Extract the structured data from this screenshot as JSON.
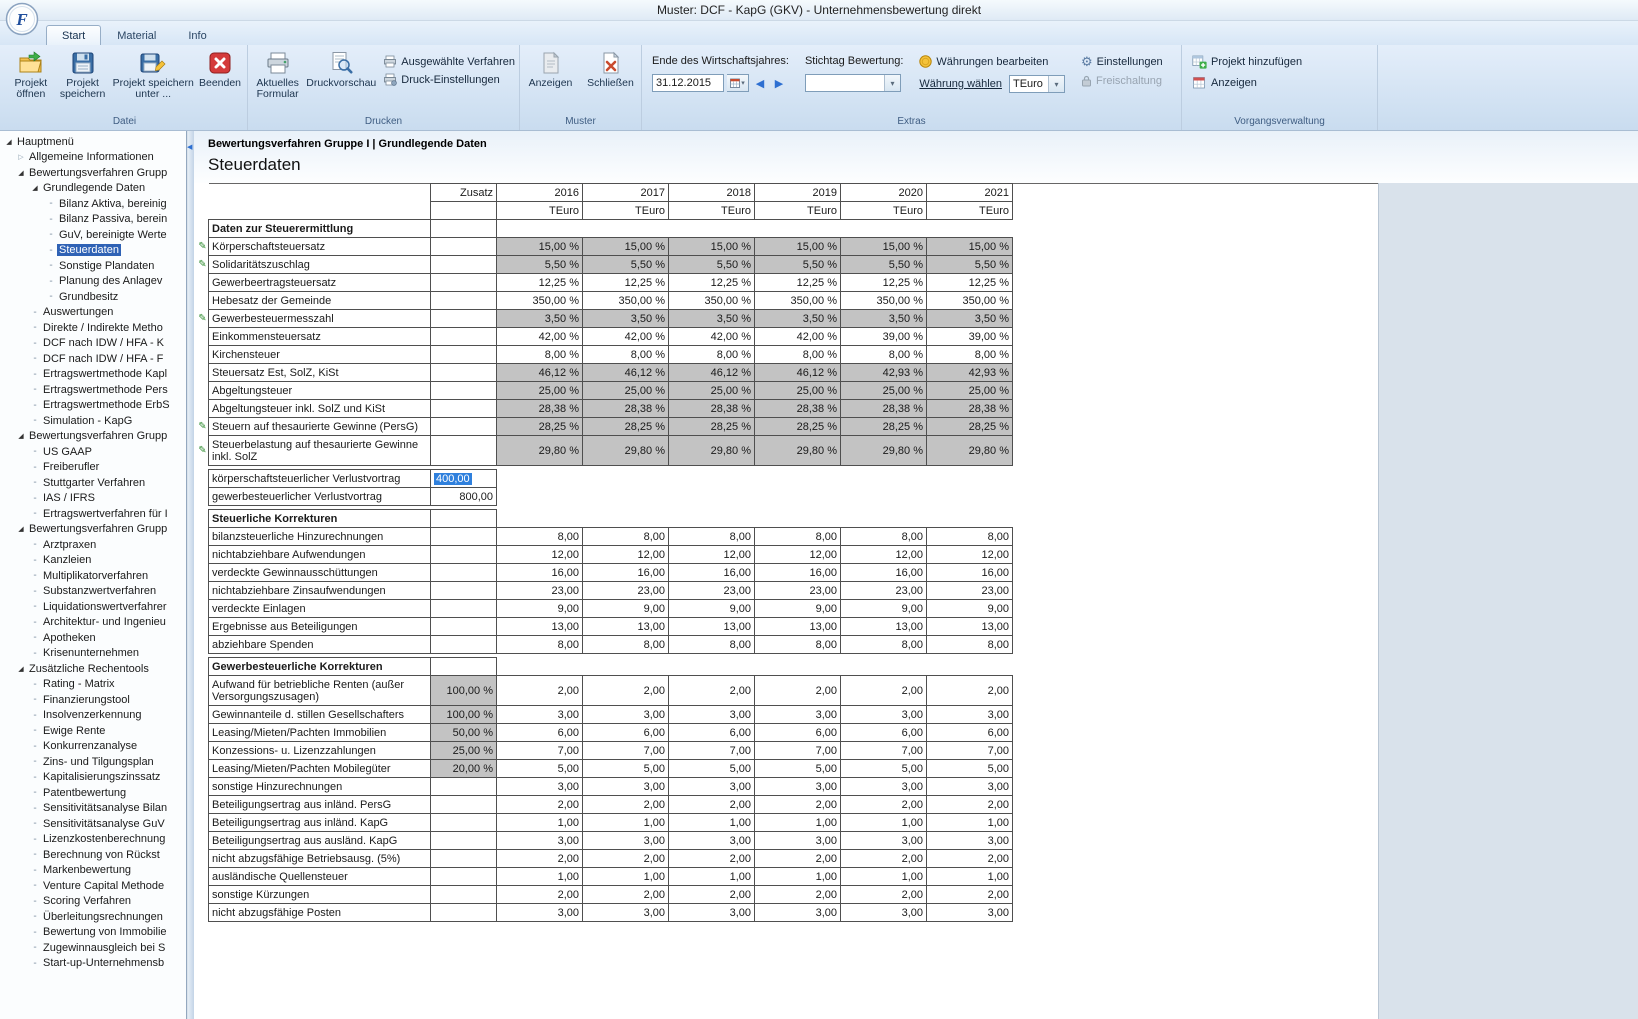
{
  "window": {
    "title": "Muster: DCF - KapG (GKV) - Unternehmensbewertung direkt"
  },
  "tabs": [
    {
      "label": "Start",
      "active": true
    },
    {
      "label": "Material",
      "active": false
    },
    {
      "label": "Info",
      "active": false
    }
  ],
  "ribbon": {
    "datei": {
      "label": "Datei",
      "open": "Projekt öffnen",
      "save": "Projekt speichern",
      "save_as": "Projekt speichern unter ...",
      "quit": "Beenden"
    },
    "drucken": {
      "label": "Drucken",
      "current_form": "Aktuelles Formular",
      "preview": "Druckvorschau",
      "selected_procedures": "Ausgewählte Verfahren",
      "print_settings": "Druck-Einstellungen"
    },
    "muster": {
      "label": "Muster",
      "show": "Anzeigen",
      "close": "Schließen"
    },
    "extras": {
      "label": "Extras",
      "fiscal_year_label": "Ende des Wirtschaftsjahres:",
      "fiscal_year_value": "31.12.2015",
      "valuation_label": "Stichtag Bewertung:",
      "valuation_value": "",
      "edit_currencies": "Währungen bearbeiten",
      "choose_currency": "Währung wählen",
      "currency_value": "TEuro",
      "settings": "Einstellungen",
      "activation": "Freischaltung"
    },
    "vorgang": {
      "label": "Vorgangsverwaltung",
      "add_project": "Projekt hinzufügen",
      "show": "Anzeigen"
    }
  },
  "content": {
    "breadcrumb": "Bewertungsverfahren Gruppe I | Grundlegende Daten",
    "title": "Steuerdaten"
  },
  "sidebar": {
    "items": [
      {
        "label": "Hauptmenü",
        "level": 0,
        "state": "expanded"
      },
      {
        "label": "Allgemeine Informationen",
        "level": 1,
        "state": "collapsed"
      },
      {
        "label": "Bewertungsverfahren Grupp",
        "level": 1,
        "state": "expanded"
      },
      {
        "label": "Grundlegende Daten",
        "level": 2,
        "state": "expanded"
      },
      {
        "label": "Bilanz Aktiva, bereinig",
        "level": 3,
        "state": "leaf"
      },
      {
        "label": "Bilanz Passiva, berein",
        "level": 3,
        "state": "leaf"
      },
      {
        "label": "GuV, bereinigte Werte",
        "level": 3,
        "state": "leaf"
      },
      {
        "label": "Steuerdaten",
        "level": 3,
        "state": "leaf",
        "selected": true
      },
      {
        "label": "Sonstige Plandaten",
        "level": 3,
        "state": "leaf"
      },
      {
        "label": "Planung des Anlagev",
        "level": 3,
        "state": "leaf"
      },
      {
        "label": "Grundbesitz",
        "level": 3,
        "state": "leaf"
      },
      {
        "label": "Auswertungen",
        "level": 2,
        "state": "leaf"
      },
      {
        "label": "Direkte / Indirekte Metho",
        "level": 2,
        "state": "leaf"
      },
      {
        "label": "DCF nach IDW / HFA - K",
        "level": 2,
        "state": "leaf"
      },
      {
        "label": "DCF nach IDW / HFA - F",
        "level": 2,
        "state": "leaf"
      },
      {
        "label": "Ertragswertmethode Kapl",
        "level": 2,
        "state": "leaf"
      },
      {
        "label": "Ertragswertmethode Pers",
        "level": 2,
        "state": "leaf"
      },
      {
        "label": "Ertragswertmethode ErbS",
        "level": 2,
        "state": "leaf"
      },
      {
        "label": "Simulation - KapG",
        "level": 2,
        "state": "leaf"
      },
      {
        "label": "Bewertungsverfahren Grupp",
        "level": 1,
        "state": "expanded"
      },
      {
        "label": "US GAAP",
        "level": 2,
        "state": "leaf"
      },
      {
        "label": "Freiberufler",
        "level": 2,
        "state": "leaf"
      },
      {
        "label": "Stuttgarter Verfahren",
        "level": 2,
        "state": "leaf"
      },
      {
        "label": "IAS / IFRS",
        "level": 2,
        "state": "leaf"
      },
      {
        "label": "Ertragswertverfahren für I",
        "level": 2,
        "state": "leaf"
      },
      {
        "label": "Bewertungsverfahren Grupp",
        "level": 1,
        "state": "expanded"
      },
      {
        "label": "Arztpraxen",
        "level": 2,
        "state": "leaf"
      },
      {
        "label": "Kanzleien",
        "level": 2,
        "state": "leaf"
      },
      {
        "label": "Multiplikatorverfahren",
        "level": 2,
        "state": "leaf"
      },
      {
        "label": "Substanzwertverfahren",
        "level": 2,
        "state": "leaf"
      },
      {
        "label": "Liquidationswertverfahrer",
        "level": 2,
        "state": "leaf"
      },
      {
        "label": "Architektur- und Ingenieu",
        "level": 2,
        "state": "leaf"
      },
      {
        "label": "Apotheken",
        "level": 2,
        "state": "leaf"
      },
      {
        "label": "Krisenunternehmen",
        "level": 2,
        "state": "leaf"
      },
      {
        "label": "Zusätzliche Rechentools",
        "level": 1,
        "state": "expanded"
      },
      {
        "label": "Rating - Matrix",
        "level": 2,
        "state": "leaf"
      },
      {
        "label": "Finanzierungstool",
        "level": 2,
        "state": "leaf"
      },
      {
        "label": "Insolvenzerkennung",
        "level": 2,
        "state": "leaf"
      },
      {
        "label": "Ewige Rente",
        "level": 2,
        "state": "leaf"
      },
      {
        "label": "Konkurrenzanalyse",
        "level": 2,
        "state": "leaf"
      },
      {
        "label": "Zins- und Tilgungsplan",
        "level": 2,
        "state": "leaf"
      },
      {
        "label": "Kapitalisierungszinssatz",
        "level": 2,
        "state": "leaf"
      },
      {
        "label": "Patentbewertung",
        "level": 2,
        "state": "leaf"
      },
      {
        "label": "Sensitivitätsanalyse Bilan",
        "level": 2,
        "state": "leaf"
      },
      {
        "label": "Sensitivitätsanalyse GuV",
        "level": 2,
        "state": "leaf"
      },
      {
        "label": "Lizenzkostenberechnung",
        "level": 2,
        "state": "leaf"
      },
      {
        "label": "Berechnung von Rückst",
        "level": 2,
        "state": "leaf"
      },
      {
        "label": "Markenbewertung",
        "level": 2,
        "state": "leaf"
      },
      {
        "label": "Venture Capital Methode",
        "level": 2,
        "state": "leaf"
      },
      {
        "label": "Scoring Verfahren",
        "level": 2,
        "state": "leaf"
      },
      {
        "label": "Überleitungsrechnungen",
        "level": 2,
        "state": "leaf"
      },
      {
        "label": "Bewertung von Immobilie",
        "level": 2,
        "state": "leaf"
      },
      {
        "label": "Zugewinnausgleich bei S",
        "level": 2,
        "state": "leaf"
      },
      {
        "label": "Start-up-Unternehmensb",
        "level": 2,
        "state": "leaf"
      }
    ]
  },
  "table": {
    "columns": [
      "Zusatz",
      "2016",
      "2017",
      "2018",
      "2019",
      "2020",
      "2021"
    ],
    "unit": "TEuro",
    "rows": [
      {
        "type": "section",
        "label": "Daten zur Steuerermittlung"
      },
      {
        "type": "data",
        "label": "Körperschaftsteuersatz",
        "pencil": true,
        "gray": true,
        "zusatz": "",
        "values": [
          "15,00 %",
          "15,00 %",
          "15,00 %",
          "15,00 %",
          "15,00 %",
          "15,00 %"
        ]
      },
      {
        "type": "data",
        "label": "Solidaritätszuschlag",
        "pencil": true,
        "gray": true,
        "zusatz": "",
        "values": [
          "5,50 %",
          "5,50 %",
          "5,50 %",
          "5,50 %",
          "5,50 %",
          "5,50 %"
        ]
      },
      {
        "type": "data",
        "label": "Gewerbeertragsteuersatz",
        "zusatz": "",
        "values": [
          "12,25 %",
          "12,25 %",
          "12,25 %",
          "12,25 %",
          "12,25 %",
          "12,25 %"
        ]
      },
      {
        "type": "data",
        "label": "Hebesatz der Gemeinde",
        "zusatz": "",
        "values": [
          "350,00 %",
          "350,00 %",
          "350,00 %",
          "350,00 %",
          "350,00 %",
          "350,00 %"
        ]
      },
      {
        "type": "data",
        "label": "Gewerbesteuermesszahl",
        "pencil": true,
        "gray": true,
        "zusatz": "",
        "values": [
          "3,50 %",
          "3,50 %",
          "3,50 %",
          "3,50 %",
          "3,50 %",
          "3,50 %"
        ]
      },
      {
        "type": "data",
        "label": "Einkommensteuersatz",
        "zusatz": "",
        "values": [
          "42,00 %",
          "42,00 %",
          "42,00 %",
          "42,00 %",
          "39,00 %",
          "39,00 %"
        ]
      },
      {
        "type": "data",
        "label": "Kirchensteuer",
        "zusatz": "",
        "values": [
          "8,00 %",
          "8,00 %",
          "8,00 %",
          "8,00 %",
          "8,00 %",
          "8,00 %"
        ]
      },
      {
        "type": "data",
        "label": "Steuersatz Est, SolZ, KiSt",
        "gray": true,
        "zusatz": "",
        "values": [
          "46,12 %",
          "46,12 %",
          "46,12 %",
          "46,12 %",
          "42,93 %",
          "42,93 %"
        ]
      },
      {
        "type": "data",
        "label": "Abgeltungsteuer",
        "gray": true,
        "zusatz": "",
        "values": [
          "25,00 %",
          "25,00 %",
          "25,00 %",
          "25,00 %",
          "25,00 %",
          "25,00 %"
        ]
      },
      {
        "type": "data",
        "label": "Abgeltungsteuer inkl. SolZ und KiSt",
        "gray": true,
        "zusatz": "",
        "values": [
          "28,38 %",
          "28,38 %",
          "28,38 %",
          "28,38 %",
          "28,38 %",
          "28,38 %"
        ]
      },
      {
        "type": "data",
        "label": "Steuern auf thesaurierte Gewinne (PersG)",
        "pencil": true,
        "gray": true,
        "zusatz": "",
        "values": [
          "28,25 %",
          "28,25 %",
          "28,25 %",
          "28,25 %",
          "28,25 %",
          "28,25 %"
        ]
      },
      {
        "type": "data",
        "label": "Steuerbelastung auf thesaurierte Gewinne inkl. SolZ",
        "pencil": true,
        "gray": true,
        "two_line": true,
        "zusatz": "",
        "values": [
          "29,80 %",
          "29,80 %",
          "29,80 %",
          "29,80 %",
          "29,80 %",
          "29,80 %"
        ]
      },
      {
        "type": "gap"
      },
      {
        "type": "zusatz_only",
        "label": "körperschaftsteuerlicher Verlustvortrag",
        "zusatz": "400,00",
        "selected": true
      },
      {
        "type": "zusatz_only",
        "label": "gewerbesteuerlicher Verlustvortrag",
        "zusatz": "800,00"
      },
      {
        "type": "gap"
      },
      {
        "type": "section",
        "label": "Steuerliche Korrekturen"
      },
      {
        "type": "data",
        "label": "bilanzsteuerliche Hinzurechnungen",
        "zusatz": "",
        "values": [
          "8,00",
          "8,00",
          "8,00",
          "8,00",
          "8,00",
          "8,00"
        ]
      },
      {
        "type": "data",
        "label": "nichtabziehbare Aufwendungen",
        "zusatz": "",
        "values": [
          "12,00",
          "12,00",
          "12,00",
          "12,00",
          "12,00",
          "12,00"
        ]
      },
      {
        "type": "data",
        "label": "verdeckte Gewinnausschüttungen",
        "zusatz": "",
        "values": [
          "16,00",
          "16,00",
          "16,00",
          "16,00",
          "16,00",
          "16,00"
        ]
      },
      {
        "type": "data",
        "label": "nichtabziehbare Zinsaufwendungen",
        "zusatz": "",
        "values": [
          "23,00",
          "23,00",
          "23,00",
          "23,00",
          "23,00",
          "23,00"
        ]
      },
      {
        "type": "data",
        "label": "verdeckte Einlagen",
        "zusatz": "",
        "values": [
          "9,00",
          "9,00",
          "9,00",
          "9,00",
          "9,00",
          "9,00"
        ]
      },
      {
        "type": "data",
        "label": "Ergebnisse aus Beteiligungen",
        "zusatz": "",
        "values": [
          "13,00",
          "13,00",
          "13,00",
          "13,00",
          "13,00",
          "13,00"
        ]
      },
      {
        "type": "data",
        "label": "abziehbare Spenden",
        "zusatz": "",
        "values": [
          "8,00",
          "8,00",
          "8,00",
          "8,00",
          "8,00",
          "8,00"
        ]
      },
      {
        "type": "gap"
      },
      {
        "type": "section",
        "label": "Gewerbesteuerliche Korrekturen"
      },
      {
        "type": "data",
        "label": "Aufwand für betriebliche Renten (außer Versorgungszusagen)",
        "two_line": true,
        "zusatz": "100,00 %",
        "zusatz_gray": true,
        "values": [
          "2,00",
          "2,00",
          "2,00",
          "2,00",
          "2,00",
          "2,00"
        ]
      },
      {
        "type": "data",
        "label": "Gewinnanteile d. stillen Gesellschafters",
        "zusatz": "100,00 %",
        "zusatz_gray": true,
        "values": [
          "3,00",
          "3,00",
          "3,00",
          "3,00",
          "3,00",
          "3,00"
        ]
      },
      {
        "type": "data",
        "label": "Leasing/Mieten/Pachten Immobilien",
        "zusatz": "50,00 %",
        "zusatz_gray": true,
        "values": [
          "6,00",
          "6,00",
          "6,00",
          "6,00",
          "6,00",
          "6,00"
        ]
      },
      {
        "type": "data",
        "label": "Konzessions- u. Lizenzzahlungen",
        "zusatz": "25,00 %",
        "zusatz_gray": true,
        "values": [
          "7,00",
          "7,00",
          "7,00",
          "7,00",
          "7,00",
          "7,00"
        ]
      },
      {
        "type": "data",
        "label": "Leasing/Mieten/Pachten Mobilegüter",
        "zusatz": "20,00 %",
        "zusatz_gray": true,
        "values": [
          "5,00",
          "5,00",
          "5,00",
          "5,00",
          "5,00",
          "5,00"
        ]
      },
      {
        "type": "data",
        "label": "sonstige Hinzurechnungen",
        "zusatz": "",
        "values": [
          "3,00",
          "3,00",
          "3,00",
          "3,00",
          "3,00",
          "3,00"
        ]
      },
      {
        "type": "data",
        "label": "Beteiligungsertrag aus inländ. PersG",
        "zusatz": "",
        "values": [
          "2,00",
          "2,00",
          "2,00",
          "2,00",
          "2,00",
          "2,00"
        ]
      },
      {
        "type": "data",
        "label": "Beteiligungsertrag aus inländ. KapG",
        "zusatz": "",
        "values": [
          "1,00",
          "1,00",
          "1,00",
          "1,00",
          "1,00",
          "1,00"
        ]
      },
      {
        "type": "data",
        "label": "Beteiligungsertrag aus ausländ. KapG",
        "zusatz": "",
        "values": [
          "3,00",
          "3,00",
          "3,00",
          "3,00",
          "3,00",
          "3,00"
        ]
      },
      {
        "type": "data",
        "label": "nicht abzugsfähige Betriebsausg. (5%)",
        "zusatz": "",
        "values": [
          "2,00",
          "2,00",
          "2,00",
          "2,00",
          "2,00",
          "2,00"
        ]
      },
      {
        "type": "data",
        "label": "ausländische Quellensteuer",
        "zusatz": "",
        "values": [
          "1,00",
          "1,00",
          "1,00",
          "1,00",
          "1,00",
          "1,00"
        ]
      },
      {
        "type": "data",
        "label": "sonstige Kürzungen",
        "zusatz": "",
        "values": [
          "2,00",
          "2,00",
          "2,00",
          "2,00",
          "2,00",
          "2,00"
        ]
      },
      {
        "type": "data",
        "label": "nicht abzugsfähige Posten",
        "zusatz": "",
        "values": [
          "3,00",
          "3,00",
          "3,00",
          "3,00",
          "3,00",
          "3,00"
        ]
      }
    ]
  }
}
